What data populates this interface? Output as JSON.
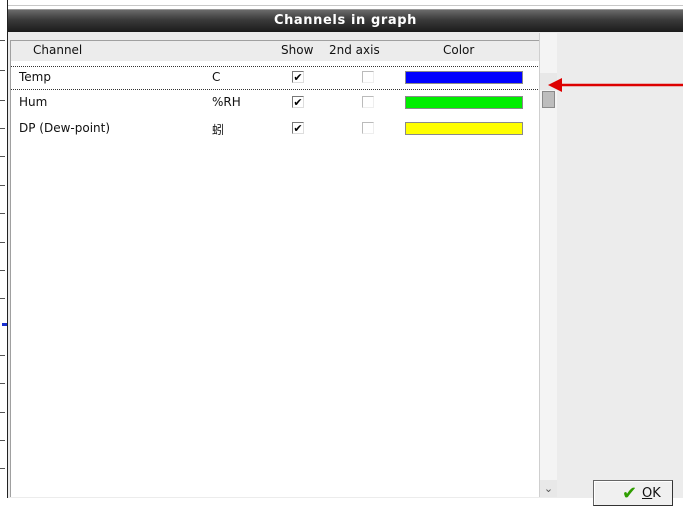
{
  "window": {
    "title": "Channels in graph"
  },
  "columns": {
    "channel": "Channel",
    "show": "Show",
    "second_axis": "2nd axis",
    "color": "Color"
  },
  "channels": [
    {
      "name": "Temp",
      "unit": "C",
      "show": true,
      "second_axis": false,
      "color": "#0000ff",
      "selected": true
    },
    {
      "name": "Hum",
      "unit": "%RH",
      "show": true,
      "second_axis": false,
      "color": "#00ee00",
      "selected": false
    },
    {
      "name": "DP (Dew-point)",
      "unit": "蚓",
      "show": true,
      "second_axis": false,
      "color": "#ffff00",
      "selected": false
    }
  ],
  "ok_button": {
    "label_underlined": "O",
    "label_rest": "K"
  },
  "check_glyph": "✔",
  "icons": {
    "ok": "checkmark-icon",
    "scroll_down": "chevron-down-icon"
  },
  "annotation": {
    "arrow_color": "#dd0000"
  }
}
